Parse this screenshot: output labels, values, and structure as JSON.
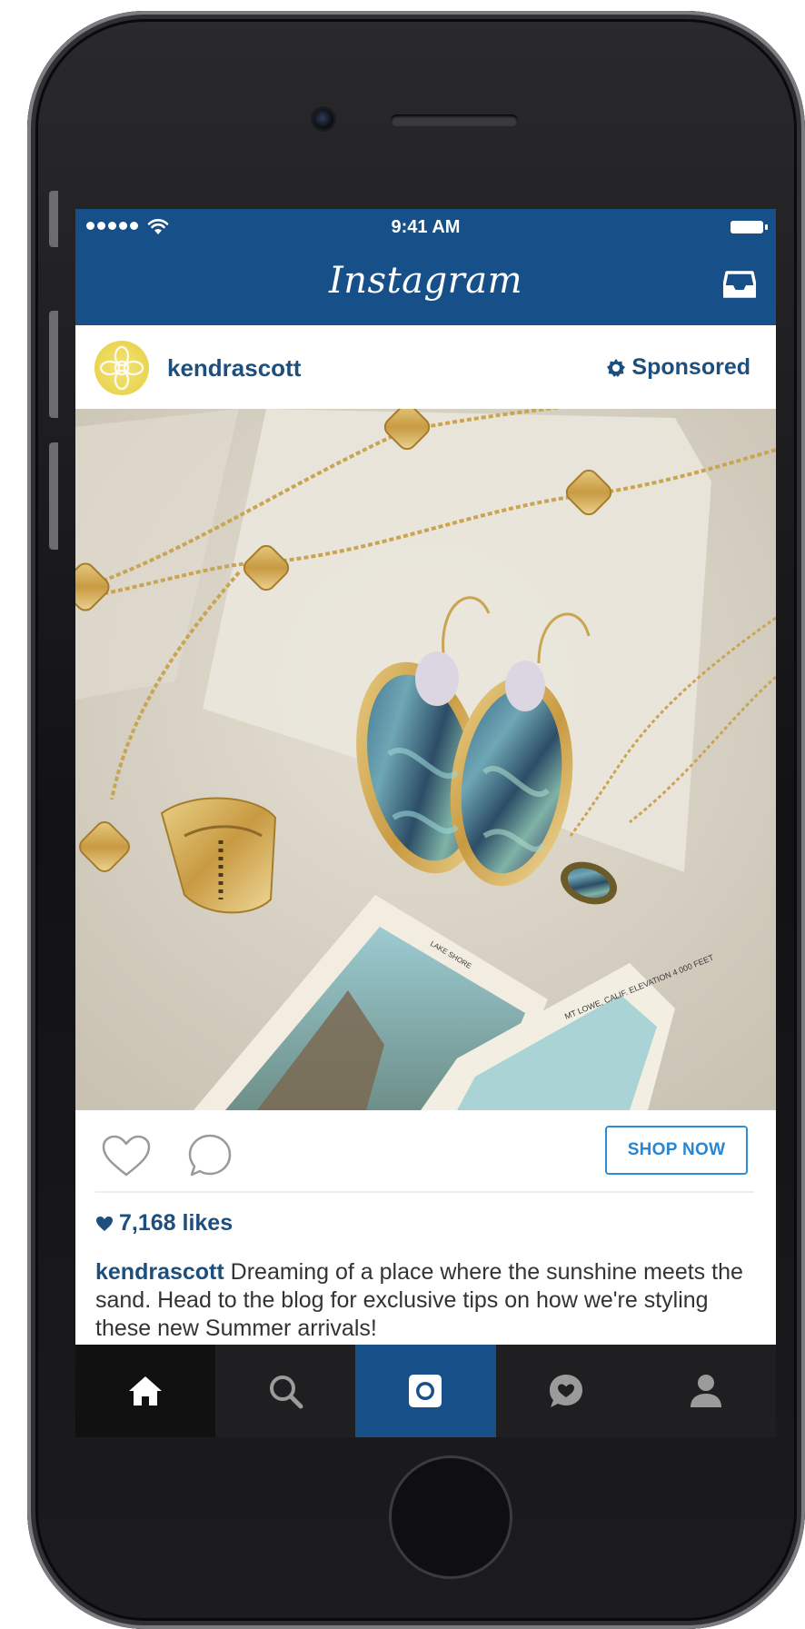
{
  "status_bar": {
    "time": "9:41 AM"
  },
  "header": {
    "title": "Instagram"
  },
  "post": {
    "username": "kendrascott",
    "sponsored_label": "Sponsored",
    "image_alt": "",
    "likes": "7,168 likes",
    "caption_user": "kendrascott",
    "caption_text": " Dreaming of a place where the sunshine meets the sand. Head to the blog for exclusive tips on how we're styling these new Summer arrivals!",
    "cta_label": "SHOP NOW"
  },
  "photo_text": {
    "postcard": "MT LOWE, CALIF. ELEVATION 4 000 FEET",
    "postcard_small": "LAKE SHORE"
  },
  "tab_bar": {
    "items": [
      "home",
      "search",
      "camera",
      "activity",
      "profile"
    ],
    "active": "home"
  },
  "colors": {
    "brand_blue": "#175088",
    "link_blue": "#1d4f7e",
    "cta_blue": "#2a8ed8",
    "tab_bar": "#1f1f21"
  }
}
